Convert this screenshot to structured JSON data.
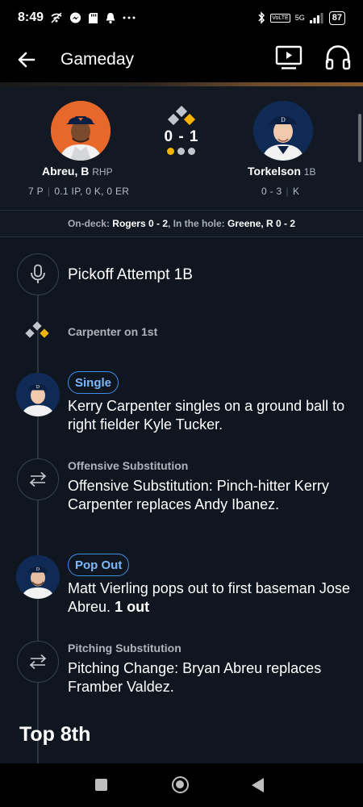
{
  "status_bar": {
    "time": "8:49",
    "network": "5G",
    "lte_badge": "VoLTE",
    "battery": "87"
  },
  "app_bar": {
    "title": "Gameday",
    "icons": [
      "back-arrow-icon",
      "tv-play-icon",
      "headphones-icon"
    ]
  },
  "matchup": {
    "pitcher": {
      "name": "Abreu, B",
      "position": "RHP",
      "stats": [
        "7 P",
        "0.1 IP, 0 K, 0 ER"
      ]
    },
    "batter": {
      "name": "Torkelson",
      "position": "1B",
      "stats": [
        "0 - 3",
        "K"
      ]
    },
    "count": "0 - 1",
    "outs": 1,
    "runners": {
      "first": true,
      "second": false,
      "third": false
    }
  },
  "on_deck": {
    "prefix": "On-deck:",
    "ondeck_player": "Rogers 0 - 2",
    "hole_prefix": ", In the hole:",
    "hole_player": "Greene, R 0 - 2"
  },
  "feed": [
    {
      "type": "event",
      "icon": "microphone-icon",
      "text": "Pickoff Attempt 1B"
    },
    {
      "type": "runner",
      "icon": "bases-diamond-icon",
      "text": "Carpenter on 1st"
    },
    {
      "type": "play",
      "badge": "Single",
      "text": "Kerry Carpenter singles on a ground ball to right fielder Kyle Tucker."
    },
    {
      "type": "substitution",
      "icon": "swap-arrows-icon",
      "label": "Offensive Substitution",
      "text": "Offensive Substitution: Pinch-hitter Kerry Carpenter replaces Andy Ibanez."
    },
    {
      "type": "play",
      "badge": "Pop Out",
      "text": "Matt Vierling pops out to first baseman Jose Abreu.",
      "emphasis": "1 out"
    },
    {
      "type": "substitution",
      "icon": "swap-arrows-icon",
      "label": "Pitching Substitution",
      "text": "Pitching Change: Bryan Abreu replaces Framber Valdez."
    }
  ],
  "inning_header": "Top 8th",
  "colors": {
    "background": "#101620",
    "accent_blue": "#3b8fe8",
    "base_runner": "#f4b400",
    "astros_orange": "#e8672b",
    "tigers_navy": "#0f2a55"
  }
}
